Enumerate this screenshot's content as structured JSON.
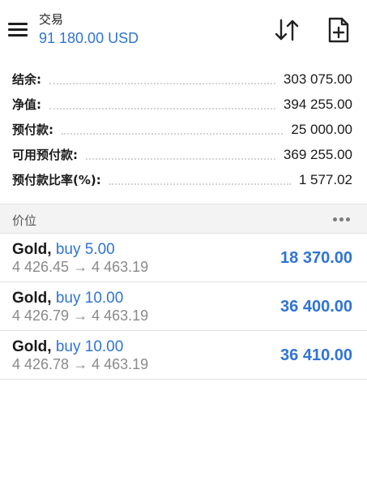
{
  "header": {
    "title": "交易",
    "balance": "91 180.00 USD",
    "menu_icon": "hamburger-menu-icon",
    "sort_icon": "sort-arrows-icon",
    "new_order_icon": "new-document-icon"
  },
  "summary": {
    "rows": [
      {
        "label": "结余:",
        "value": "303 075.00"
      },
      {
        "label": "净值:",
        "value": "394 255.00"
      },
      {
        "label": "预付款:",
        "value": "25 000.00"
      },
      {
        "label": "可用预付款:",
        "value": "369 255.00"
      },
      {
        "label": "预付款比率(%):",
        "value": "1 577.02"
      }
    ]
  },
  "positions_section": {
    "title": "价位",
    "more_icon": "more-dots-icon"
  },
  "positions": [
    {
      "symbol": "Gold,",
      "side": " buy 5.00",
      "prices": "4 426.45 → 4 463.19",
      "profit": "18 370.00"
    },
    {
      "symbol": "Gold,",
      "side": " buy 10.00",
      "prices": "4 426.79 → 4 463.19",
      "profit": "36 400.00"
    },
    {
      "symbol": "Gold,",
      "side": " buy 10.00",
      "prices": "4 426.78 → 4 463.19",
      "profit": "36 410.00"
    }
  ],
  "colors": {
    "accent": "#2f74d6",
    "text": "#1a1a1a",
    "muted": "#8a8a8a",
    "section_bg": "#f3f3f3"
  }
}
